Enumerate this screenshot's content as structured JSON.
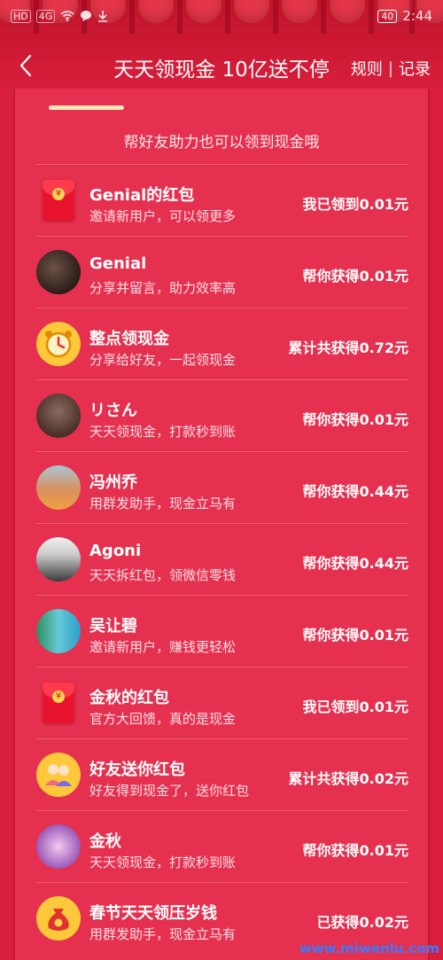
{
  "status_bar": {
    "left_badges": [
      "HD",
      "4G"
    ],
    "battery": "40",
    "time": "2:44"
  },
  "header": {
    "title": "天天领现金 10亿送不停",
    "rules_link": "规则",
    "separator": "|",
    "records_link": "记录"
  },
  "subtitle": "帮好友助力也可以领到现金哦",
  "list": [
    {
      "name": "Genial的红包",
      "desc": "邀请新用户，可以领更多",
      "amount": "我已领到0.01元",
      "avatar": "red-envelope-icon"
    },
    {
      "name": "Genial",
      "desc": "分享并留言，助力效率高",
      "amount": "帮你获得0.01元",
      "avatar": "user-photo"
    },
    {
      "name": "整点领现金",
      "desc": "分享给好友，一起领现金",
      "amount": "累计共获得0.72元",
      "avatar": "alarm-clock-icon"
    },
    {
      "name": "リさん",
      "desc": "天天领现金，打款秒到账",
      "amount": "帮你获得0.01元",
      "avatar": "user-photo"
    },
    {
      "name": "冯州乔",
      "desc": "用群发助手，现金立马有",
      "amount": "帮你获得0.44元",
      "avatar": "user-photo"
    },
    {
      "name": "Agoni",
      "desc": "天天拆红包，领微信零钱",
      "amount": "帮你获得0.44元",
      "avatar": "user-photo"
    },
    {
      "name": "吴让碧",
      "desc": "邀请新用户，赚钱更轻松",
      "amount": "帮你获得0.01元",
      "avatar": "user-photo"
    },
    {
      "name": "金秋的红包",
      "desc": "官方大回馈，真的是现金",
      "amount": "我已领到0.01元",
      "avatar": "red-envelope-icon"
    },
    {
      "name": "好友送你红包",
      "desc": "好友得到现金了，送你红包",
      "amount": "累计共获得0.02元",
      "avatar": "friends-icon"
    },
    {
      "name": "金秋",
      "desc": "天天领现金，打款秒到账",
      "amount": "帮你获得0.01元",
      "avatar": "user-photo"
    },
    {
      "name": "春节天天领压岁钱",
      "desc": "用群发助手，现金立马有",
      "amount": "已获得0.02元",
      "avatar": "money-bag-icon"
    }
  ],
  "watermark": "www.miwenlu.com"
}
